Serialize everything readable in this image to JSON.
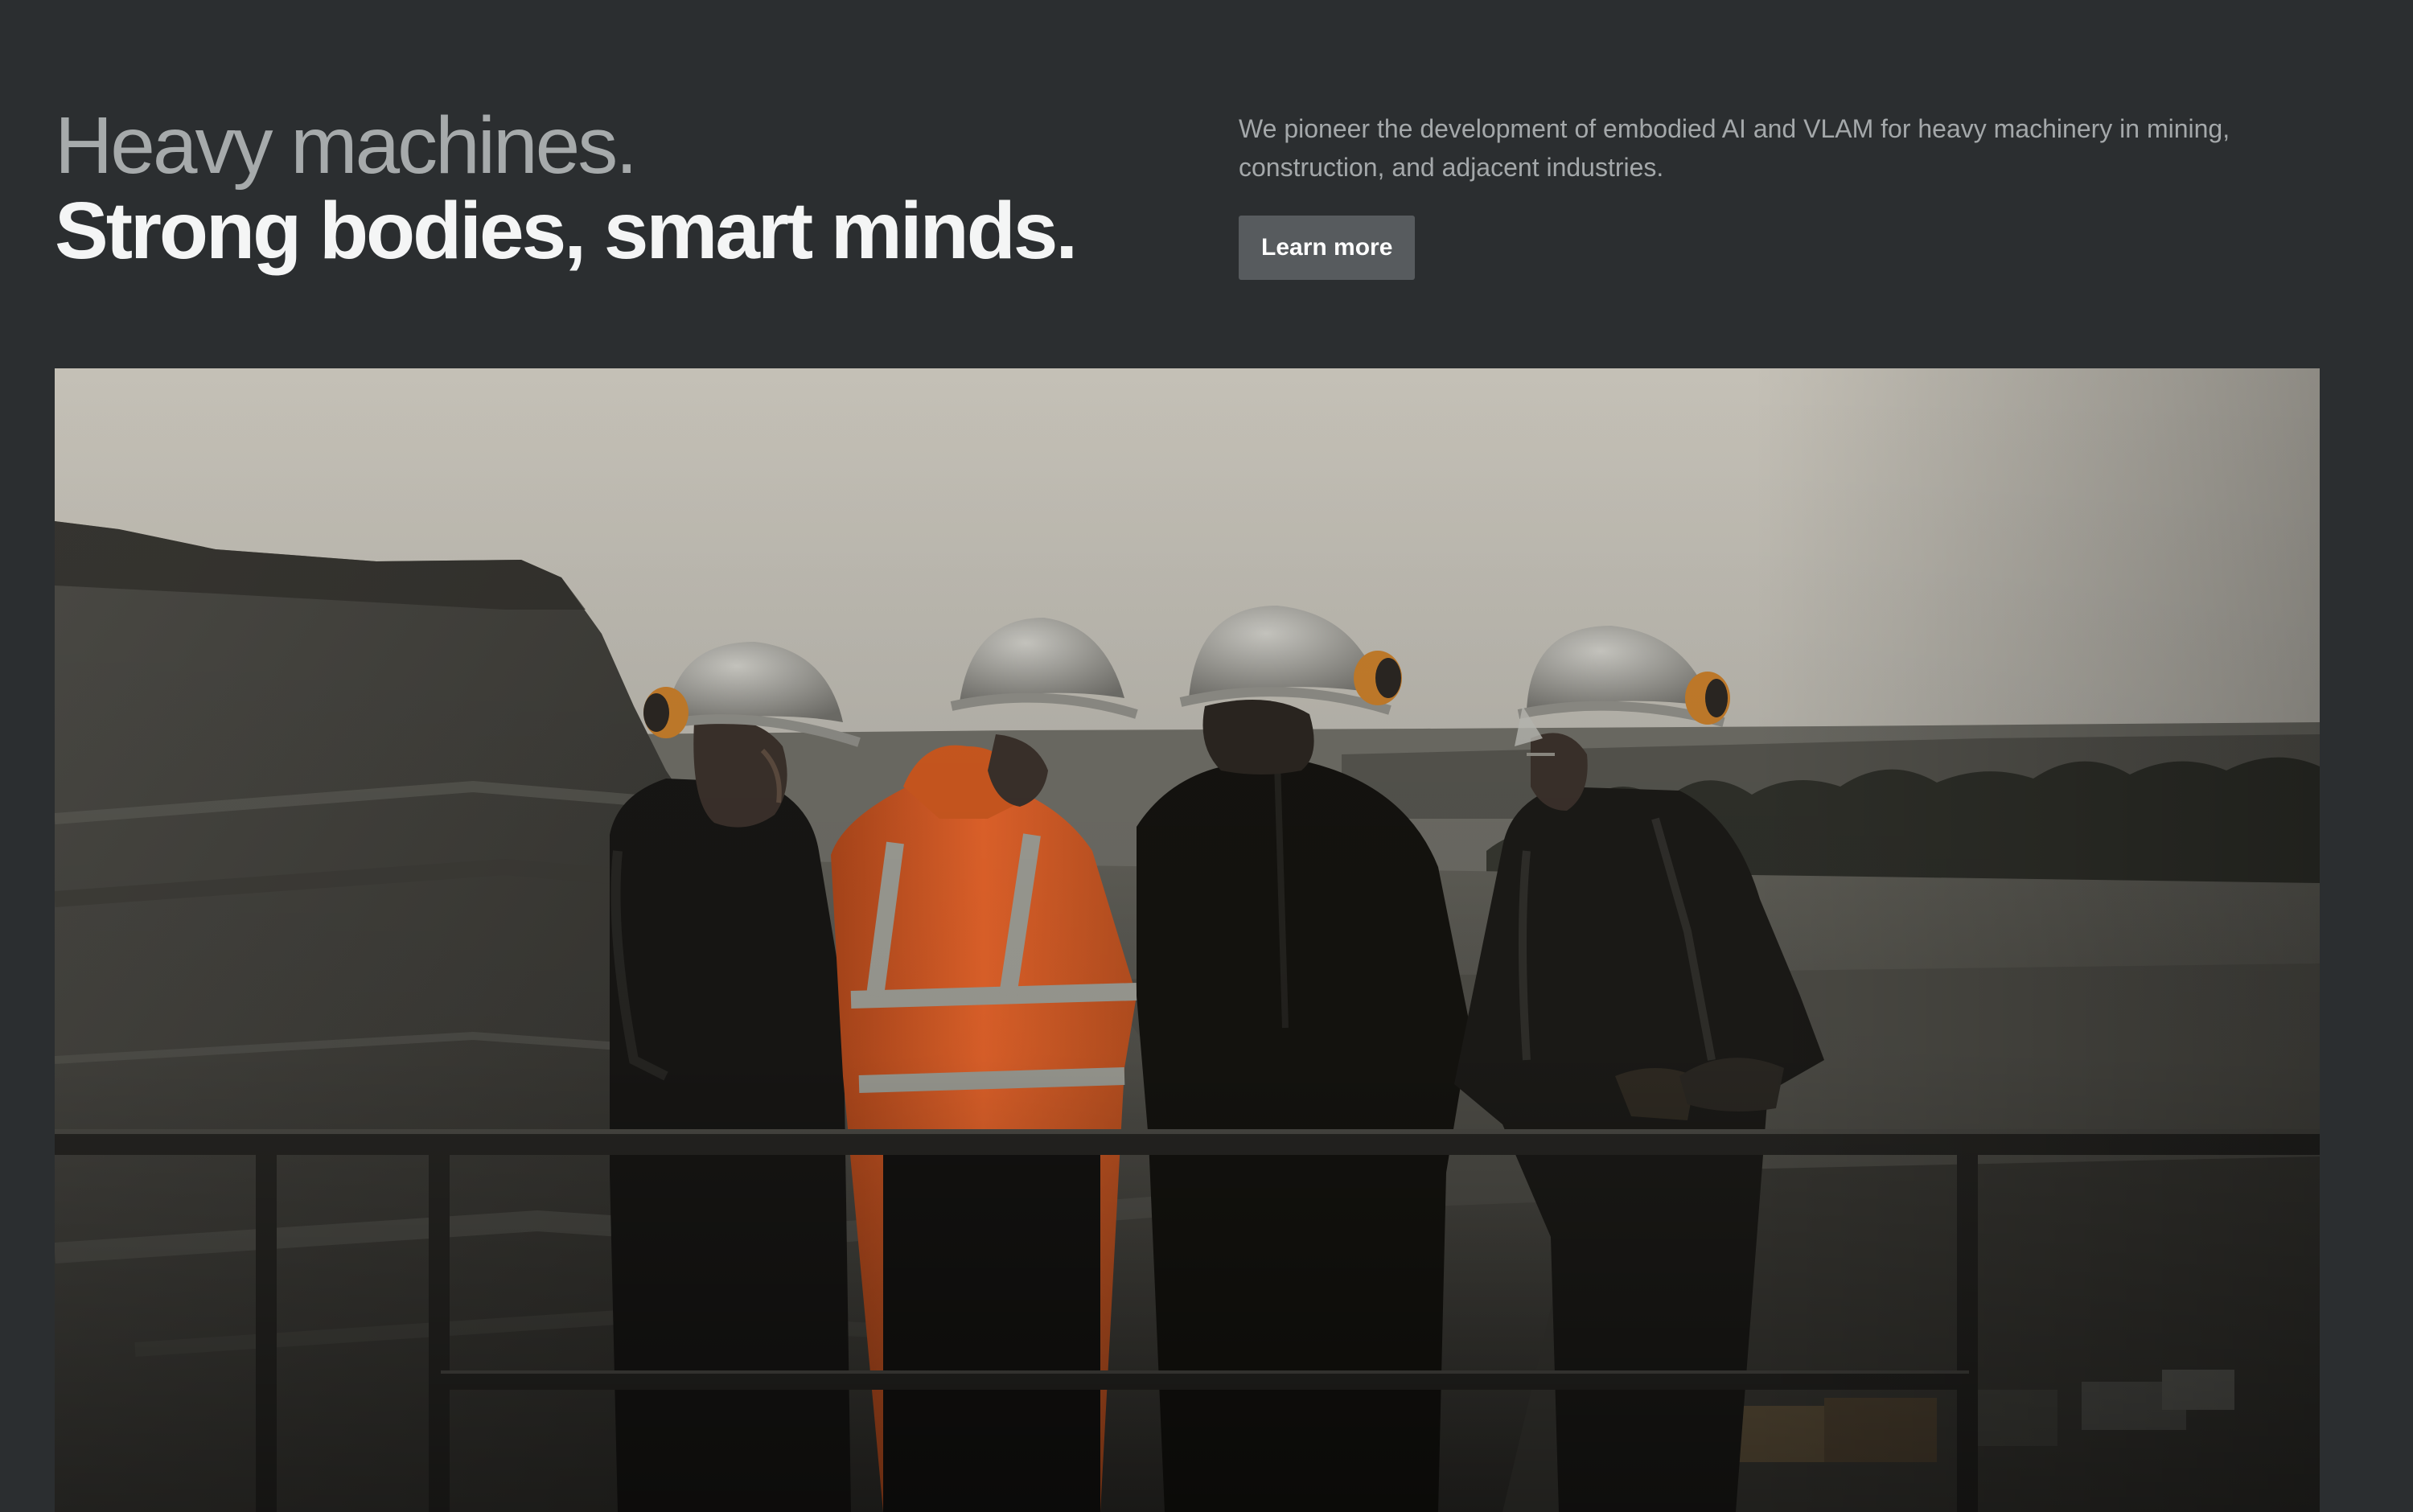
{
  "hero": {
    "headline_line1": "Heavy machines.",
    "headline_line2": "Strong bodies, smart minds.",
    "description": "We pioneer the development of embodied AI and VLAM for heavy machinery in mining, construction, and adjacent industries.",
    "cta_label": "Learn more"
  },
  "image": {
    "icon": "hero-photo",
    "subject": "workers-at-mine-railing"
  },
  "colors": {
    "background": "#2b2e30",
    "headline_muted": "#a6aaab",
    "headline_strong": "#f4f5f5",
    "body_text": "#a4a8aa",
    "button_bg": "#575b5e",
    "button_text": "#ffffff",
    "safety_orange": "#e0622a"
  }
}
